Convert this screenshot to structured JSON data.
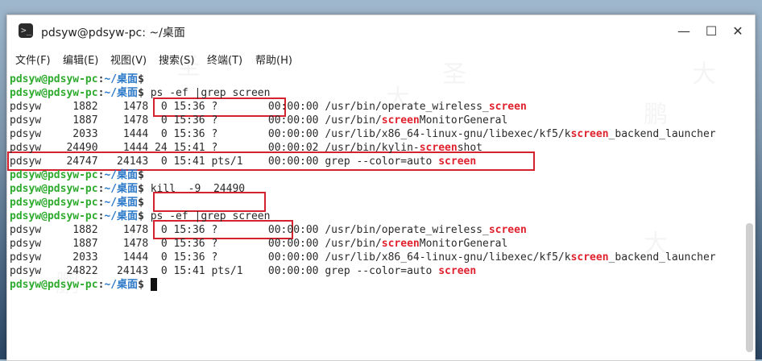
{
  "window": {
    "title": "pdsyw@pdsyw-pc: ~/桌面",
    "icon": "terminal-icon",
    "controls": {
      "minimize": "—",
      "maximize": "☐",
      "close": "✕"
    }
  },
  "menu": [
    "文件(F)",
    "编辑(E)",
    "视图(V)",
    "搜索(S)",
    "终端(T)",
    "帮助(H)"
  ],
  "prompt": {
    "user_host": "pdsyw@pdsyw-pc",
    "colon": ":",
    "dir": "~/桌面",
    "symbol": "$"
  },
  "terminal_lines": [
    {
      "type": "prompt",
      "cmd": ""
    },
    {
      "type": "prompt",
      "cmd": "ps -ef |grep screen"
    },
    {
      "type": "out",
      "pre": "pdsyw     1882    1478  0 15:36 ?        00:00:00 /usr/bin/operate_wireless_",
      "hl": "screen",
      "post": ""
    },
    {
      "type": "out",
      "pre": "pdsyw     1887    1478  0 15:36 ?        00:00:00 /usr/bin/",
      "hl": "screen",
      "post": "MonitorGeneral"
    },
    {
      "type": "out",
      "pre": "pdsyw     2033    1444  0 15:36 ?        00:00:00 /usr/lib/x86_64-linux-gnu/libexec/kf5/k",
      "hl": "screen",
      "post": "_backend_launcher"
    },
    {
      "type": "out",
      "pre": "pdsyw    24490    1444 24 15:41 ?        00:00:02 /usr/bin/kylin-",
      "hl": "screen",
      "post": "shot"
    },
    {
      "type": "out",
      "pre": "pdsyw    24747   24143  0 15:41 pts/1    00:00:00 grep --color=auto ",
      "hl": "screen",
      "post": ""
    },
    {
      "type": "prompt",
      "cmd": ""
    },
    {
      "type": "prompt",
      "cmd": "kill  -9  24490"
    },
    {
      "type": "prompt",
      "cmd": ""
    },
    {
      "type": "prompt",
      "cmd": "ps -ef |grep screen"
    },
    {
      "type": "out",
      "pre": "pdsyw     1882    1478  0 15:36 ?        00:00:00 /usr/bin/operate_wireless_",
      "hl": "screen",
      "post": ""
    },
    {
      "type": "out",
      "pre": "pdsyw     1887    1478  0 15:36 ?        00:00:00 /usr/bin/",
      "hl": "screen",
      "post": "MonitorGeneral"
    },
    {
      "type": "out",
      "pre": "pdsyw     2033    1444  0 15:36 ?        00:00:00 /usr/lib/x86_64-linux-gnu/libexec/kf5/k",
      "hl": "screen",
      "post": "_backend_launcher"
    },
    {
      "type": "out",
      "pre": "pdsyw    24822   24143  0 15:41 pts/1    00:00:00 grep --color=auto ",
      "hl": "screen",
      "post": ""
    },
    {
      "type": "prompt",
      "cmd": "",
      "cursor": true
    }
  ],
  "colors": {
    "prompt_user": "#2eab2e",
    "prompt_dir": "#2a78c8",
    "match_highlight": "#e0212d",
    "annotation_box": "#d4222e"
  },
  "watermark": [
    "大",
    "圣",
    "鹏"
  ]
}
